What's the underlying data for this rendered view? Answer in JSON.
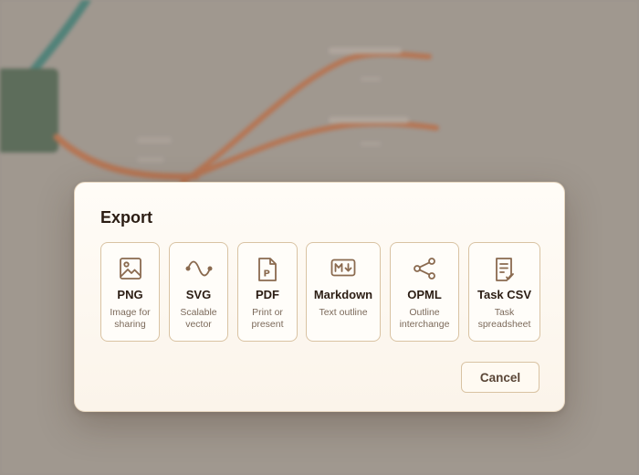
{
  "dialog": {
    "title": "Export",
    "options": [
      {
        "name": "PNG",
        "desc": "Image for sharing",
        "icon": "image-icon"
      },
      {
        "name": "SVG",
        "desc": "Scalable vector",
        "icon": "wave-icon"
      },
      {
        "name": "PDF",
        "desc": "Print or present",
        "icon": "pdf-file-icon"
      },
      {
        "name": "Markdown",
        "desc": "Text outline",
        "icon": "markdown-icon"
      },
      {
        "name": "OPML",
        "desc": "Outline interchange",
        "icon": "share-nodes-icon"
      },
      {
        "name": "Task CSV",
        "desc": "Task spreadsheet",
        "icon": "spreadsheet-doc-icon"
      }
    ],
    "cancel_label": "Cancel"
  },
  "colors": {
    "accent": "#8a6a4f",
    "border": "#d9c3a3",
    "title_text": "#2b1d14",
    "muted_text": "#7c6a5b",
    "branch": "#c8693a",
    "teal_branch": "#2e7d74",
    "root_node": "#3f5c45"
  }
}
